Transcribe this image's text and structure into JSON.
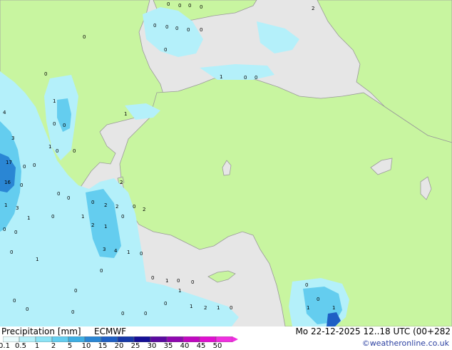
{
  "footer": {
    "title": "Precipitation [mm]",
    "model": "ECMWF",
    "datetime": "Mo 22-12-2025 12..18 UTC (00+282",
    "credit": "©weatheronline.co.uk"
  },
  "legend": {
    "ticks": [
      "0.1",
      "0.5",
      "1",
      "2",
      "5",
      "10",
      "15",
      "20",
      "25",
      "30",
      "35",
      "40",
      "45",
      "50"
    ],
    "colors": [
      "#e8fbfd",
      "#b4f0fa",
      "#8ce3f5",
      "#64cdef",
      "#3eaee3",
      "#2a86d4",
      "#1e5fc4",
      "#1638a8",
      "#150f96",
      "#5a0aa0",
      "#8f08b0",
      "#c008c0",
      "#e010d0",
      "#f030e0"
    ]
  },
  "colors": {
    "land": "#c8f5a0",
    "sea": "#e6e6e6",
    "coast": "#9a9a9a",
    "precip_light": "#b4f0fa",
    "precip_medium": "#64cdef",
    "precip_heavy": "#2a86d4"
  },
  "map": {
    "values": [
      {
        "t": "0"
      },
      {
        "t": "0"
      },
      {
        "t": "0"
      },
      {
        "t": "0"
      },
      {
        "t": "2"
      },
      {
        "t": "0"
      },
      {
        "t": "0"
      },
      {
        "t": "0"
      },
      {
        "t": "0"
      },
      {
        "t": "0"
      },
      {
        "t": "0"
      },
      {
        "t": "0"
      },
      {
        "t": "1"
      },
      {
        "t": "0"
      },
      {
        "t": "0"
      },
      {
        "t": "1"
      },
      {
        "t": "0"
      },
      {
        "t": "1"
      },
      {
        "t": "0"
      },
      {
        "t": "4"
      },
      {
        "t": "3"
      },
      {
        "t": "0"
      },
      {
        "t": "0"
      },
      {
        "t": "1"
      },
      {
        "t": "0"
      },
      {
        "t": "0"
      },
      {
        "t": "17"
      },
      {
        "t": "0"
      },
      {
        "t": "16"
      },
      {
        "t": "0"
      },
      {
        "t": "2"
      },
      {
        "t": "1"
      },
      {
        "t": "3"
      },
      {
        "t": "0"
      },
      {
        "t": "0"
      },
      {
        "t": "2"
      },
      {
        "t": "0"
      },
      {
        "t": "2"
      },
      {
        "t": "0"
      },
      {
        "t": "2"
      },
      {
        "t": "1"
      },
      {
        "t": "0"
      },
      {
        "t": "1"
      },
      {
        "t": "0"
      },
      {
        "t": "2"
      },
      {
        "t": "1"
      },
      {
        "t": "0"
      },
      {
        "t": "0"
      },
      {
        "t": "3"
      },
      {
        "t": "4"
      },
      {
        "t": "1"
      },
      {
        "t": "0"
      },
      {
        "t": "0"
      },
      {
        "t": "1"
      },
      {
        "t": "0"
      },
      {
        "t": "0"
      },
      {
        "t": "1"
      },
      {
        "t": "0"
      },
      {
        "t": "0"
      },
      {
        "t": "1"
      },
      {
        "t": "1"
      },
      {
        "t": "2"
      },
      {
        "t": "1"
      },
      {
        "t": "0"
      },
      {
        "t": "0"
      },
      {
        "t": "1"
      },
      {
        "t": "1"
      },
      {
        "t": "0"
      },
      {
        "t": "0"
      },
      {
        "t": "0"
      },
      {
        "t": "0"
      },
      {
        "t": "0"
      },
      {
        "t": "0"
      },
      {
        "t": "0"
      },
      {
        "t": "0"
      }
    ]
  }
}
